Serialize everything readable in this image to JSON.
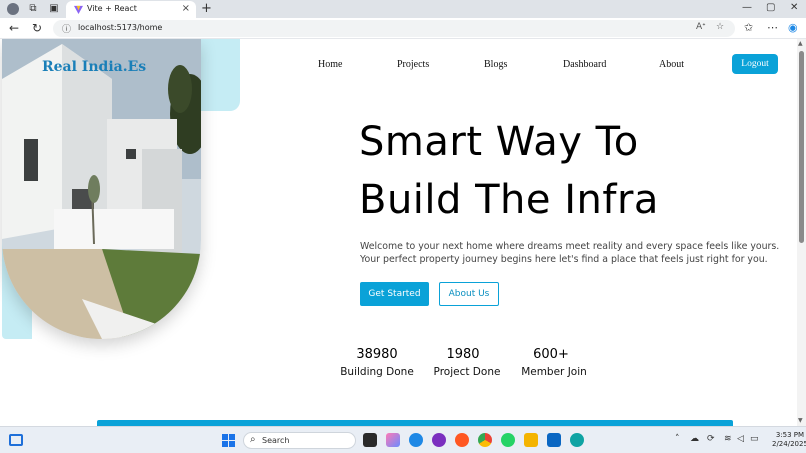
{
  "browser": {
    "tab_title": "Vite + React",
    "tab_close": "×",
    "new_tab": "+",
    "url": "localhost:5173/home",
    "win_min": "—",
    "win_max": "▢",
    "win_close": "✕"
  },
  "site": {
    "brand": "Real India.Es",
    "nav": [
      "Home",
      "Projects",
      "Blogs",
      "Dashboard",
      "About"
    ],
    "logout": "Logout"
  },
  "hero": {
    "headline_1": "Smart Way To",
    "headline_2": "Build The Infra",
    "desc_1": "Welcome to your next home where dreams meet reality and every space feels like yours.",
    "desc_2": "Your perfect property journey begins here let's find a place that feels just right for you.",
    "primary_button": "Get Started",
    "secondary_button": "About Us"
  },
  "stats": [
    {
      "value": "38980",
      "label": "Building Done"
    },
    {
      "value": "1980",
      "label": "Project Done"
    },
    {
      "value": "600+",
      "label": "Member Join"
    }
  ],
  "taskbar": {
    "search_label": "Search",
    "time": "3:53 PM",
    "date": "2/24/2025"
  },
  "colors": {
    "accent": "#0aa2d8",
    "brand": "#1a7fb8",
    "panel": "#c5ecf4"
  }
}
